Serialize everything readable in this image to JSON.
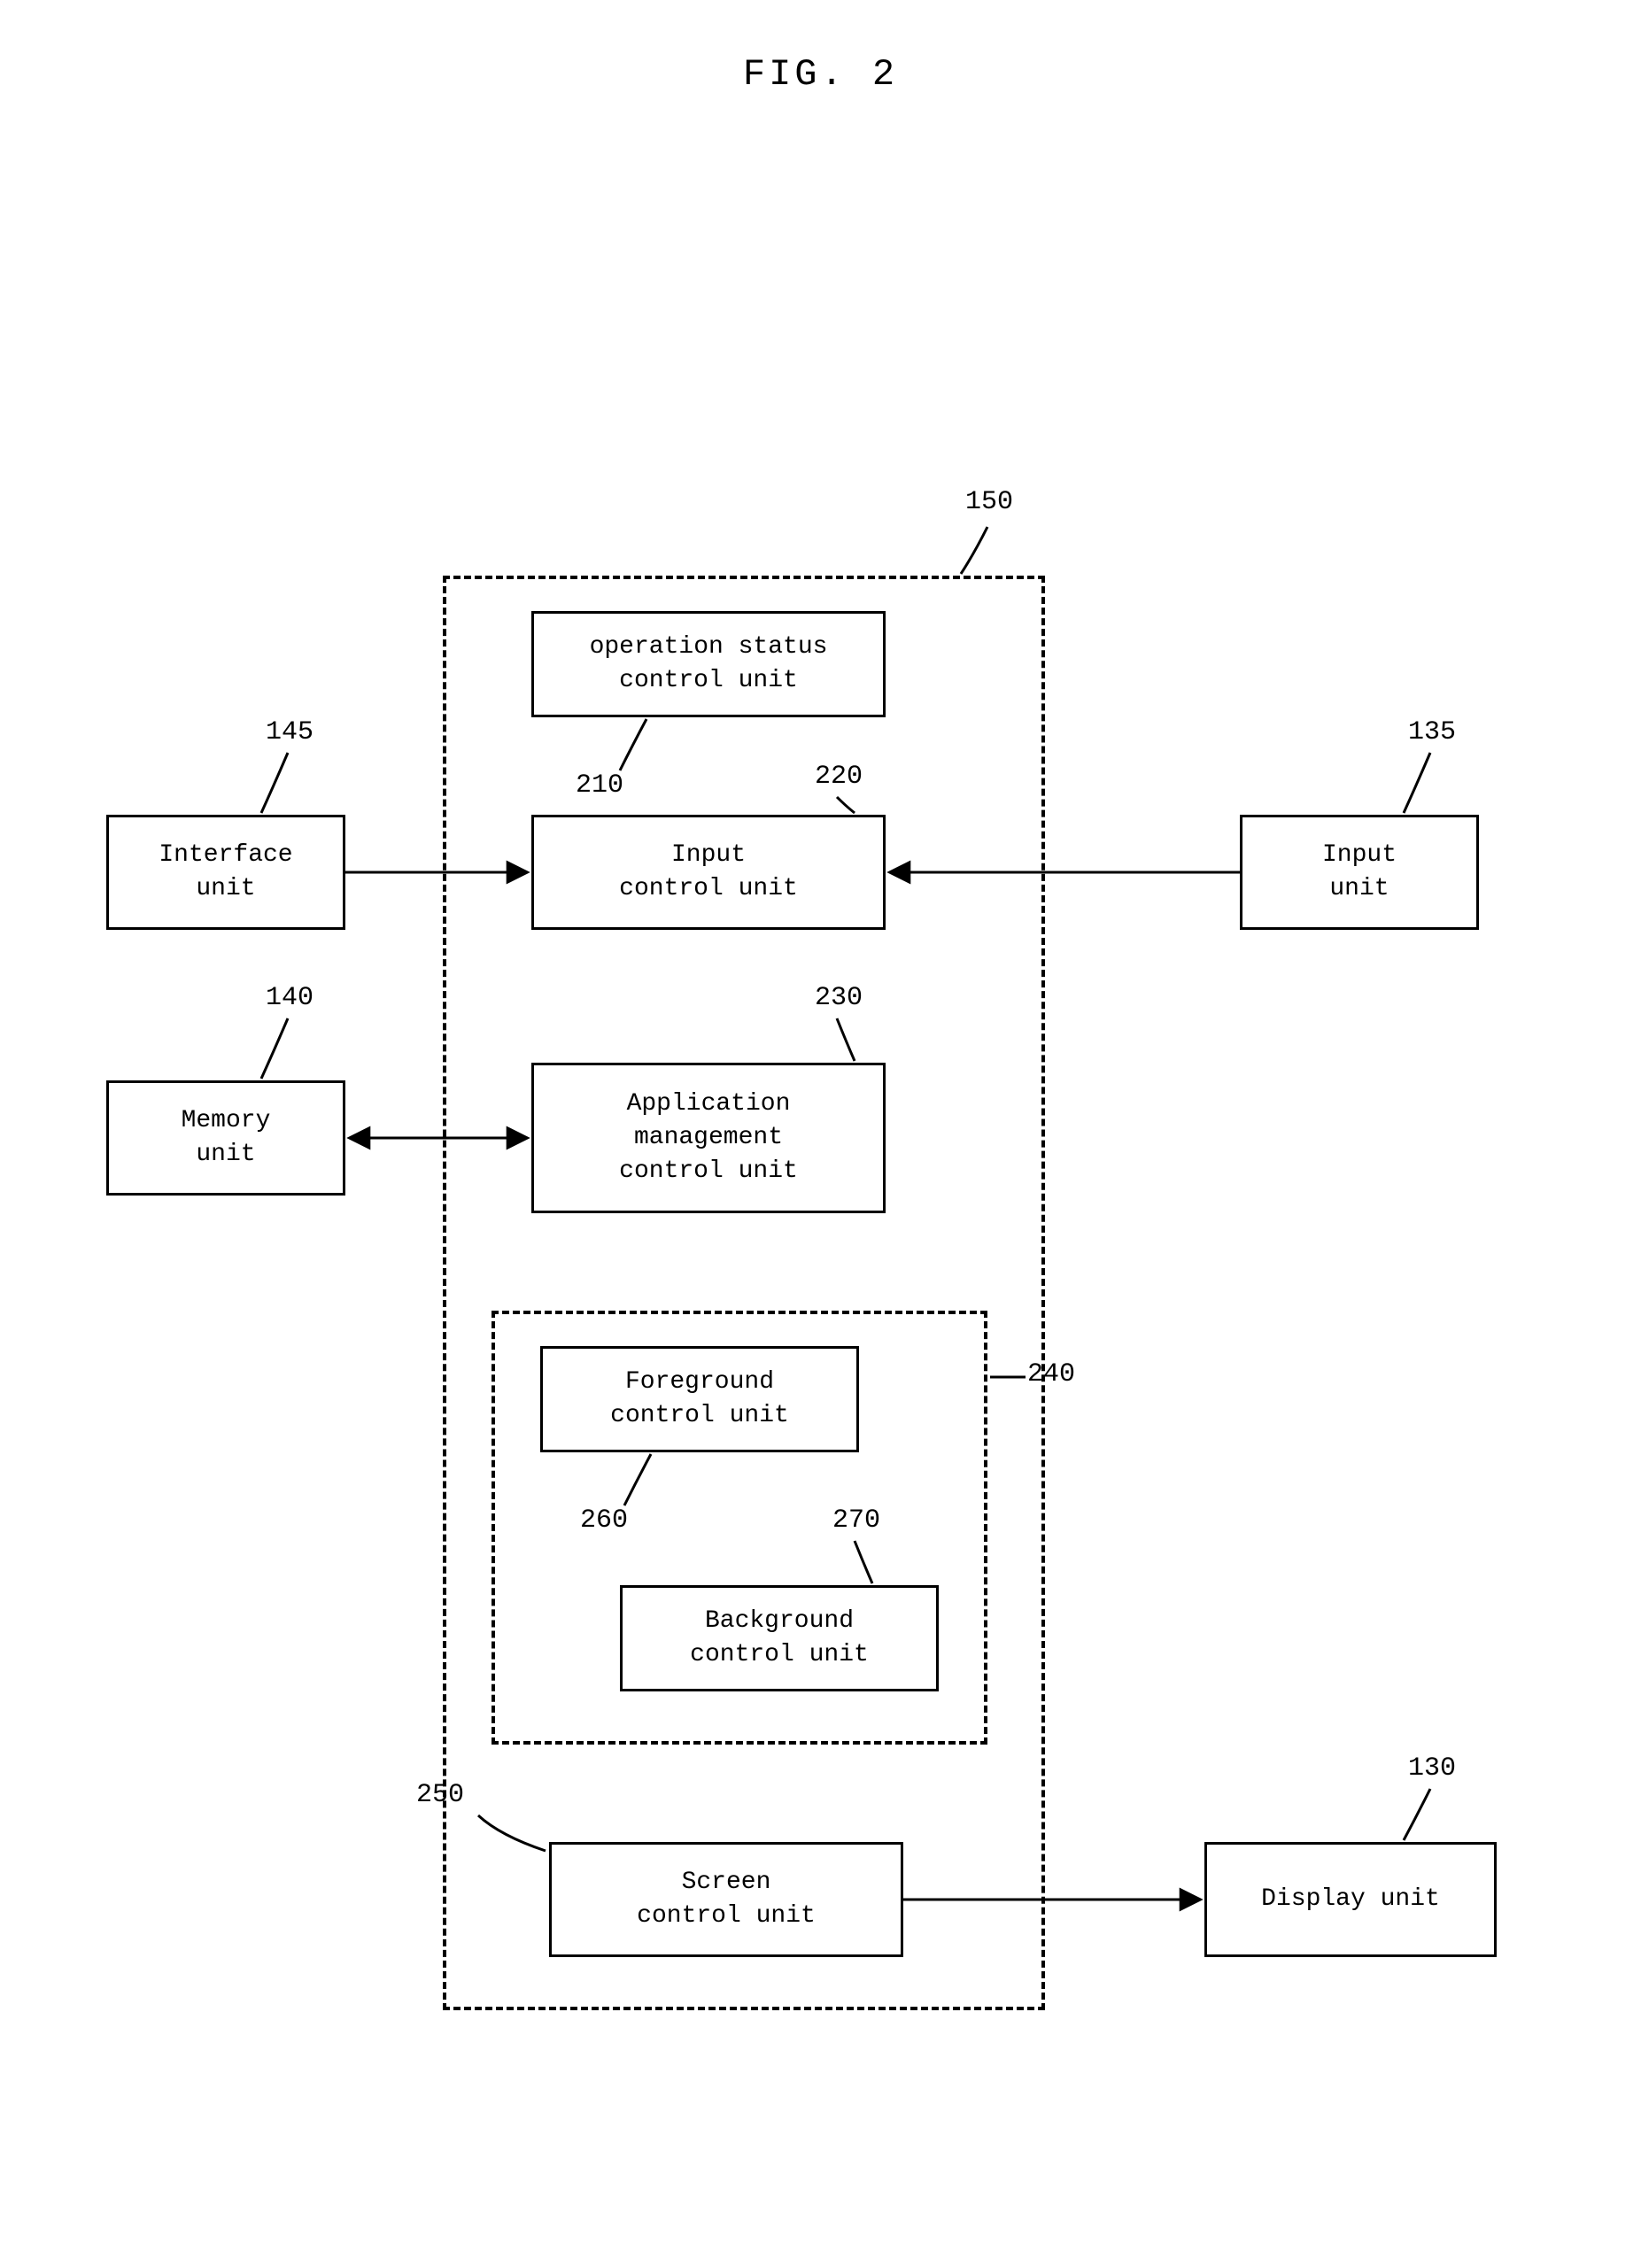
{
  "figure_title": "FIG. 2",
  "labels": {
    "n150": "150",
    "n145": "145",
    "n135": "135",
    "n140": "140",
    "n210": "210",
    "n220": "220",
    "n230": "230",
    "n240": "240",
    "n250": "250",
    "n260": "260",
    "n270": "270",
    "n130": "130"
  },
  "boxes": {
    "interface_unit": "Interface\nunit",
    "input_unit": "Input\nunit",
    "memory_unit": "Memory\nunit",
    "operation_status_control_unit": "operation status\ncontrol unit",
    "input_control_unit": "Input\ncontrol unit",
    "application_management_control_unit": "Application\nmanagement\ncontrol unit",
    "foreground_control_unit": "Foreground\ncontrol unit",
    "background_control_unit": "Background\ncontrol unit",
    "screen_control_unit": "Screen\ncontrol unit",
    "display_unit": "Display unit"
  }
}
